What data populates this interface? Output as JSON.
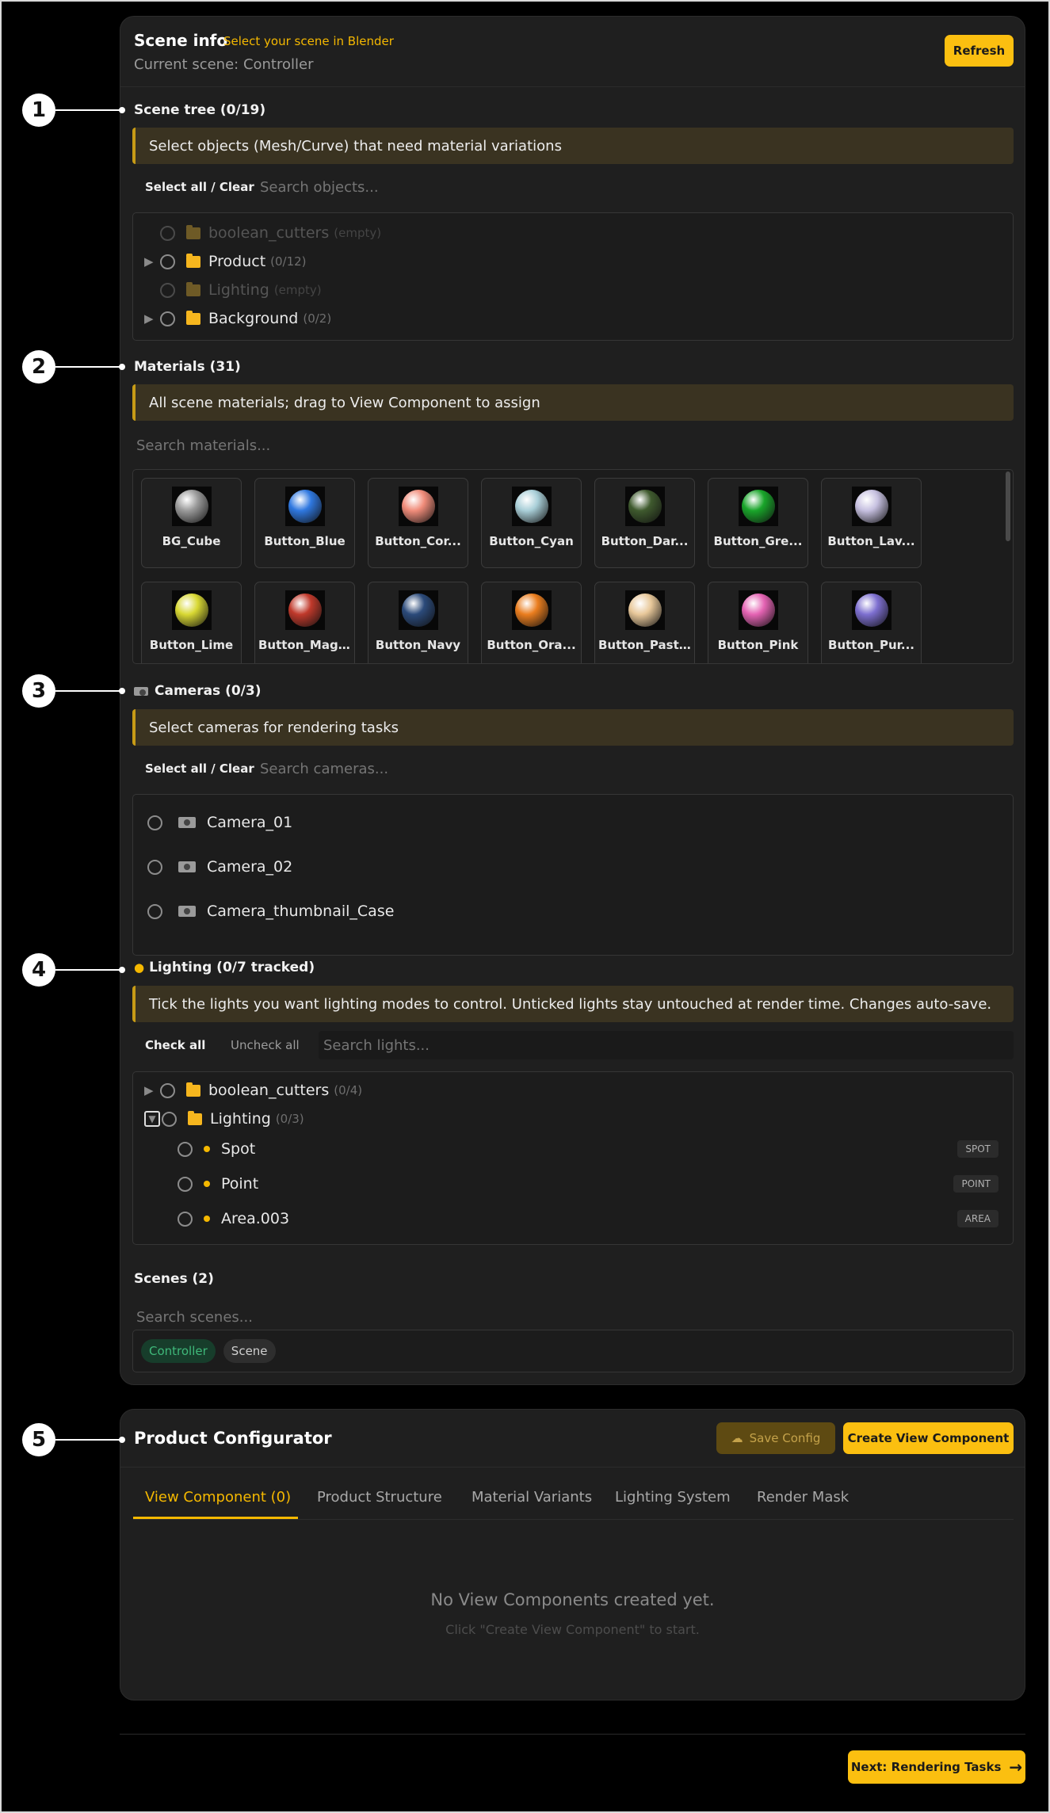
{
  "header": {
    "title": "Scene info",
    "hint": "Select your scene in Blender",
    "current_scene": "Current scene: Controller",
    "refresh_label": "Refresh"
  },
  "scene_tree": {
    "title": "Scene tree (0/19)",
    "notice": "Select objects (Mesh/Curve) that need material variations",
    "select_all_label": "Select all / Clear",
    "search_placeholder": "Search objects...",
    "items": [
      {
        "name": "boolean_cutters",
        "count": "(empty)"
      },
      {
        "name": "Product",
        "count": "(0/12)"
      },
      {
        "name": "Lighting",
        "count": "(empty)"
      },
      {
        "name": "Background",
        "count": "(0/2)"
      }
    ]
  },
  "materials": {
    "title": "Materials (31)",
    "notice": "All scene materials; drag to View Component to assign",
    "search_placeholder": "Search materials...",
    "items": [
      {
        "label": "BG_Cube",
        "color": "#9a9a9a"
      },
      {
        "label": "Button_Blue",
        "color": "#2f78e0"
      },
      {
        "label": "Button_Cor...",
        "color": "#f08c7a"
      },
      {
        "label": "Button_Cyan",
        "color": "#a9cfd8"
      },
      {
        "label": "Button_Dar...",
        "color": "#3f5a2e"
      },
      {
        "label": "Button_Gre...",
        "color": "#19a52a"
      },
      {
        "label": "Button_Lav...",
        "color": "#c6c0e0"
      },
      {
        "label": "Button_Lime",
        "color": "#d8d833"
      },
      {
        "label": "Button_Mag...",
        "color": "#c0392b"
      },
      {
        "label": "Button_Navy",
        "color": "#2b4a7a"
      },
      {
        "label": "Button_Ora...",
        "color": "#ea7d1e"
      },
      {
        "label": "Button_Past...",
        "color": "#e8c89a"
      },
      {
        "label": "Button_Pink",
        "color": "#e463b3"
      },
      {
        "label": "Button_Pur...",
        "color": "#7d6fd0"
      }
    ]
  },
  "cameras": {
    "title": "Cameras (0/3)",
    "notice": "Select cameras for rendering tasks",
    "select_all_label": "Select all / Clear",
    "search_placeholder": "Search cameras...",
    "items": [
      "Camera_01",
      "Camera_02",
      "Camera_thumbnail_Case"
    ]
  },
  "lighting": {
    "title": "Lighting (0/7 tracked)",
    "notice": "Tick the lights you want lighting modes to control. Unticked lights stay untouched at render time. Changes auto-save.",
    "check_all_label": "Check all",
    "uncheck_all_label": "Uncheck all",
    "search_placeholder": "Search lights...",
    "groups": [
      {
        "name": "boolean_cutters",
        "count": "(0/4)"
      },
      {
        "name": "Lighting",
        "count": "(0/3)"
      }
    ],
    "lights": [
      {
        "name": "Spot",
        "type": "SPOT"
      },
      {
        "name": "Point",
        "type": "POINT"
      },
      {
        "name": "Area.003",
        "type": "AREA"
      }
    ]
  },
  "scenes": {
    "title": "Scenes (2)",
    "search_placeholder": "Search scenes...",
    "items": [
      "Controller",
      "Scene"
    ]
  },
  "configurator": {
    "title": "Product Configurator",
    "save_label": "Save Config",
    "create_label": "Create View Component",
    "tabs": [
      "View Component (0)",
      "Product Structure",
      "Material Variants",
      "Lighting System",
      "Render Mask"
    ],
    "empty_title": "No View Components created yet.",
    "empty_hint": "Click \"Create View Component\" to start."
  },
  "footer": {
    "next_label": "Next: Rendering Tasks"
  },
  "callouts": [
    "1",
    "2",
    "3",
    "4",
    "5"
  ],
  "colors": {
    "accent": "#fbbf10",
    "panel": "#1f1f1f",
    "notice_bg": "#3a3321",
    "scene_active": "#3fb87a"
  }
}
